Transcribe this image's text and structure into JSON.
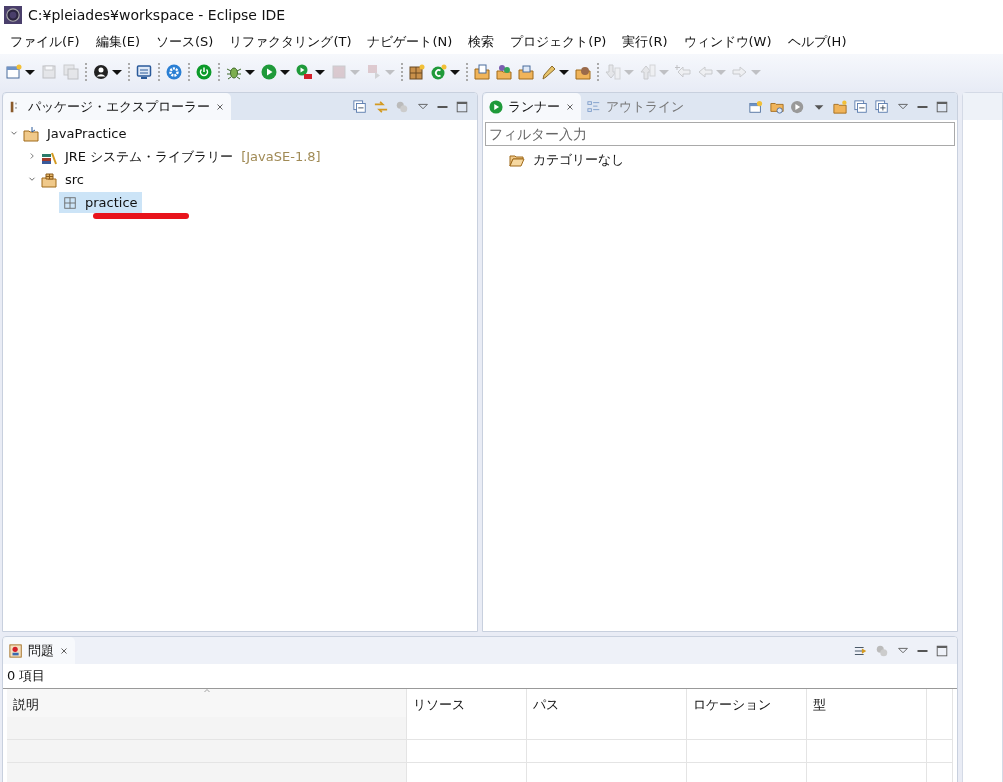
{
  "window": {
    "title": "C:¥pleiades¥workspace - Eclipse IDE"
  },
  "menu": [
    "ファイル(F)",
    "編集(E)",
    "ソース(S)",
    "リファクタリング(T)",
    "ナビゲート(N)",
    "検索",
    "プロジェクト(P)",
    "実行(R)",
    "ウィンドウ(W)",
    "ヘルプ(H)"
  ],
  "toolbar": [
    {
      "kind": "new",
      "dropdown": true,
      "disabled": false
    },
    {
      "kind": "save",
      "dropdown": false,
      "disabled": true
    },
    {
      "kind": "save-all",
      "dropdown": false,
      "disabled": true
    },
    {
      "kind": "separator"
    },
    {
      "kind": "person",
      "dropdown": true,
      "disabled": false
    },
    {
      "kind": "separator"
    },
    {
      "kind": "monitor",
      "dropdown": false,
      "disabled": false
    },
    {
      "kind": "separator"
    },
    {
      "kind": "gear",
      "dropdown": false,
      "disabled": false
    },
    {
      "kind": "separator"
    },
    {
      "kind": "power",
      "dropdown": false,
      "disabled": false
    },
    {
      "kind": "separator"
    },
    {
      "kind": "bug",
      "dropdown": true,
      "disabled": false
    },
    {
      "kind": "play",
      "dropdown": true,
      "disabled": false
    },
    {
      "kind": "play-tool",
      "dropdown": true,
      "disabled": false
    },
    {
      "kind": "stop",
      "dropdown": true,
      "disabled": true
    },
    {
      "kind": "step",
      "dropdown": true,
      "disabled": true
    },
    {
      "kind": "separator"
    },
    {
      "kind": "grid-new",
      "dropdown": false,
      "disabled": false
    },
    {
      "kind": "class-new",
      "dropdown": true,
      "disabled": false
    },
    {
      "kind": "separator"
    },
    {
      "kind": "folder-doc",
      "dropdown": false,
      "disabled": false
    },
    {
      "kind": "folder-dots",
      "dropdown": false,
      "disabled": false
    },
    {
      "kind": "folder-case",
      "dropdown": false,
      "disabled": false
    },
    {
      "kind": "pen",
      "dropdown": true,
      "disabled": false
    },
    {
      "kind": "folder-ball",
      "dropdown": false,
      "disabled": false
    },
    {
      "kind": "separator"
    },
    {
      "kind": "arrow-down",
      "dropdown": true,
      "disabled": true
    },
    {
      "kind": "arrow-up",
      "dropdown": true,
      "disabled": true
    },
    {
      "kind": "arrow-star",
      "dropdown": false,
      "disabled": true
    },
    {
      "kind": "arrow-left",
      "dropdown": true,
      "disabled": true
    },
    {
      "kind": "arrow-right",
      "dropdown": true,
      "disabled": true
    }
  ],
  "package_explorer": {
    "tabs": [
      {
        "label": "パッケージ・エクスプローラー",
        "selected": true
      }
    ],
    "tree": [
      {
        "label": "JavaPractice",
        "kind": "project",
        "expanded": true,
        "children": [
          {
            "label": "JRE システム・ライブラリー",
            "suffix": "[JavaSE-1.8]",
            "kind": "library",
            "expanded": false
          },
          {
            "label": "src",
            "kind": "source-folder",
            "expanded": true,
            "children": [
              {
                "label": "practice",
                "kind": "package",
                "selected": true,
                "underlined": true
              }
            ]
          }
        ]
      }
    ]
  },
  "runner": {
    "tabs": [
      {
        "label": "ランナー",
        "selected": true
      },
      {
        "label": "アウトライン",
        "selected": false
      }
    ],
    "filter": {
      "placeholder": "フィルター入力"
    },
    "items": [
      {
        "label": "カテゴリーなし"
      }
    ]
  },
  "problems": {
    "tabs": [
      {
        "label": "問題",
        "selected": true
      }
    ],
    "count": "0 項目",
    "columns": [
      {
        "label": "説明",
        "sorted": true
      },
      {
        "label": "リソース",
        "sorted": false
      },
      {
        "label": "パス",
        "sorted": false
      },
      {
        "label": "ロケーション",
        "sorted": false
      },
      {
        "label": "型",
        "sorted": false
      }
    ]
  }
}
